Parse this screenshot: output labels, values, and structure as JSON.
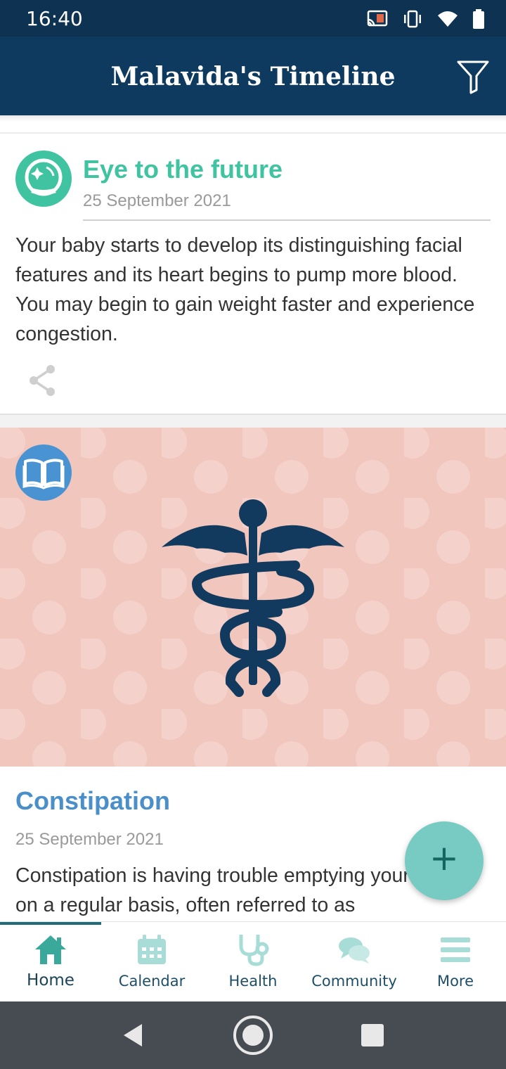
{
  "status_bar": {
    "time": "16:40",
    "icons": [
      "cast-icon",
      "vibrate-icon",
      "wifi-icon",
      "battery-icon"
    ]
  },
  "app_bar": {
    "title": "Malavida's Timeline",
    "filter_icon": "filter-icon"
  },
  "cards": [
    {
      "icon": "crystal-ball-icon",
      "icon_color": "#3fc3a0",
      "title": "Eye to the future",
      "date": "25 September 2021",
      "body": "Your baby starts to develop its distinguishing facial features and its heart begins to pump more blood.  You may begin to gain weight faster and experience congestion.",
      "share_icon": "share-icon"
    },
    {
      "badge_icon": "book-icon",
      "badge_color": "#4a93d2",
      "hero_icon": "caduceus-icon",
      "hero_bg": "#f0c6bd",
      "title": "Constipation",
      "date": "25 September 2021",
      "body": "Constipation is having trouble emptying your bowels on a regular basis, often referred to as"
    }
  ],
  "fab": {
    "icon": "plus-icon",
    "label": "+"
  },
  "bottom_nav": {
    "active": "Home",
    "items": [
      {
        "label": "Home",
        "icon": "home-icon"
      },
      {
        "label": "Calendar",
        "icon": "calendar-icon"
      },
      {
        "label": "Health",
        "icon": "stethoscope-icon"
      },
      {
        "label": "Community",
        "icon": "chat-bubbles-icon"
      },
      {
        "label": "More",
        "icon": "menu-icon"
      }
    ]
  },
  "system_nav": [
    "back-icon",
    "home-circle-icon",
    "recents-icon"
  ],
  "colors": {
    "primary": "#0f3a5f",
    "accent": "#78cbc3",
    "teal_title": "#40c3a0",
    "blue_title": "#4a8fc8"
  }
}
